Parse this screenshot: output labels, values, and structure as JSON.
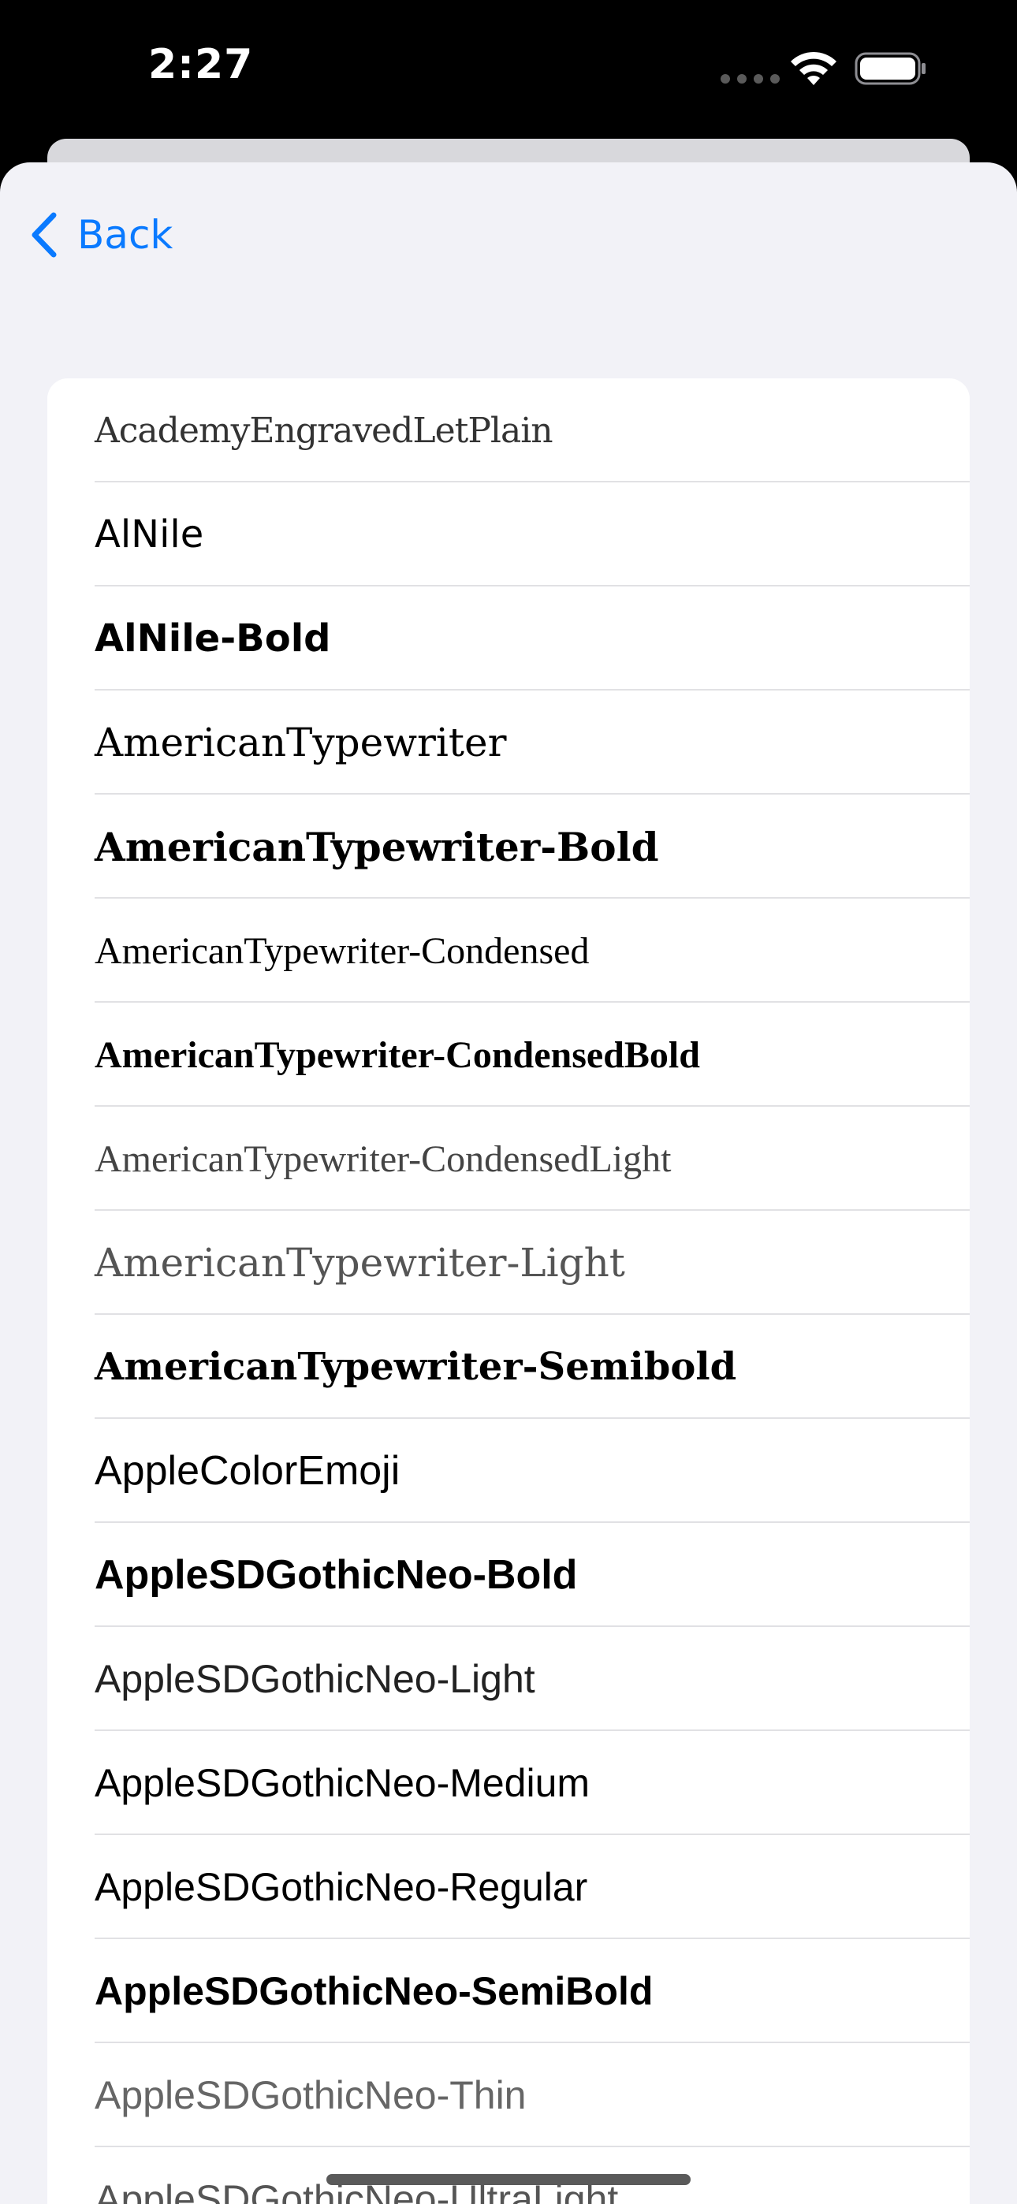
{
  "status_bar": {
    "time": "2:27",
    "icons": [
      "signal-icon",
      "wifi-icon",
      "battery-icon"
    ]
  },
  "nav": {
    "back_label": "Back",
    "back_icon": "chevron-left-icon",
    "accent_color": "#0a7aff"
  },
  "font_list": {
    "items": [
      "AcademyEngravedLetPlain",
      "AlNile",
      "AlNile-Bold",
      "AmericanTypewriter",
      "AmericanTypewriter-Bold",
      "AmericanTypewriter-Condensed",
      "AmericanTypewriter-CondensedBold",
      "AmericanTypewriter-CondensedLight",
      "AmericanTypewriter-Light",
      "AmericanTypewriter-Semibold",
      "AppleColorEmoji",
      "AppleSDGothicNeo-Bold",
      "AppleSDGothicNeo-Light",
      "AppleSDGothicNeo-Medium",
      "AppleSDGothicNeo-Regular",
      "AppleSDGothicNeo-SemiBold",
      "AppleSDGothicNeo-Thin",
      "AppleSDGothicNeo-UltraLight"
    ]
  },
  "colors": {
    "background": "#f2f2f7",
    "card": "#ffffff",
    "separator": "#e1e1e4"
  }
}
